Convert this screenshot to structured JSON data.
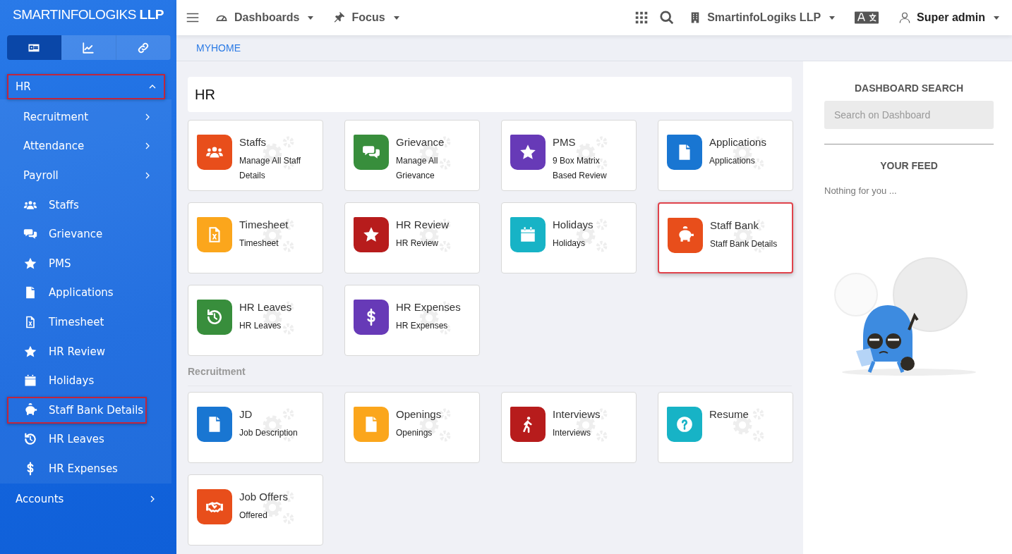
{
  "sidebar": {
    "brand": "SMARTINFOLOGIKS **LLP**",
    "tabs": [
      {
        "selected": true
      },
      {
        "selected": false
      },
      {
        "selected": false
      }
    ],
    "menu": [
      {
        "label": "HR",
        "expanded": true,
        "highlighted": true,
        "children": [
          {
            "label": "Recruitment",
            "kind": "group",
            "highlighted": false
          },
          {
            "label": "Attendance",
            "kind": "group",
            "highlighted": false
          },
          {
            "label": "Payroll",
            "kind": "group",
            "highlighted": false
          },
          {
            "label": "Staffs",
            "kind": "link",
            "highlighted": false
          },
          {
            "label": "Grievance",
            "kind": "link",
            "highlighted": false
          },
          {
            "label": "PMS",
            "kind": "link",
            "highlighted": false
          },
          {
            "label": "Applications",
            "kind": "link",
            "highlighted": false
          },
          {
            "label": "Timesheet",
            "kind": "link",
            "highlighted": false
          },
          {
            "label": "HR Review",
            "kind": "link",
            "highlighted": false
          },
          {
            "label": "Holidays",
            "kind": "link",
            "highlighted": false
          },
          {
            "label": "Staff Bank Details",
            "kind": "link",
            "highlighted": true
          },
          {
            "label": "HR Leaves",
            "kind": "link",
            "highlighted": false
          },
          {
            "label": "HR Expenses",
            "kind": "link",
            "highlighted": false
          }
        ]
      },
      {
        "label": "Accounts",
        "expanded": false,
        "highlighted": false
      }
    ]
  },
  "topbar": {
    "menus": [
      {
        "label": "Dashboards"
      },
      {
        "label": "Focus"
      }
    ],
    "company": "SmartinfoLogiks LLP",
    "user": "Super admin"
  },
  "breadcrumb": "MYHOME",
  "sections": [
    {
      "title": "HR",
      "kind": "panel",
      "cards": [
        {
          "title": "Staffs",
          "description": "Manage All Staff Details",
          "color": "#e84e1b",
          "highlighted": false
        },
        {
          "title": "Grievance",
          "description": "Manage All Grievance",
          "color": "#388e3c",
          "highlighted": false
        },
        {
          "title": "PMS",
          "description": "9 Box Matrix Based Review",
          "color": "#673ab7",
          "highlighted": false
        },
        {
          "title": "Applications",
          "description": "Applications",
          "color": "#1976d2",
          "highlighted": false
        },
        {
          "title": "Timesheet",
          "description": "Timesheet",
          "color": "#fba61c",
          "highlighted": false
        },
        {
          "title": "HR Review",
          "description": "HR Review",
          "color": "#b71c1c",
          "highlighted": false
        },
        {
          "title": "Holidays",
          "description": "Holidays",
          "color": "#17b3c6",
          "highlighted": false
        },
        {
          "title": "Staff Bank",
          "description": "Staff Bank Details",
          "color": "#e84e1b",
          "highlighted": true
        },
        {
          "title": "HR Leaves",
          "description": "HR Leaves",
          "color": "#388e3c",
          "highlighted": false
        },
        {
          "title": "HR Expenses",
          "description": "HR Expenses",
          "color": "#673ab7",
          "highlighted": false
        }
      ]
    },
    {
      "title": "Recruitment",
      "kind": "plain",
      "cards": [
        {
          "title": "JD",
          "description": "Job Description",
          "color": "#1976d2",
          "highlighted": false
        },
        {
          "title": "Openings",
          "description": "Openings",
          "color": "#fba61c",
          "highlighted": false
        },
        {
          "title": "Interviews",
          "description": "Interviews",
          "color": "#b71c1c",
          "highlighted": false
        },
        {
          "title": "Resume",
          "color": "#17b3c6",
          "highlighted": false
        },
        {
          "title": "Job Offers",
          "description": "Offered",
          "color": "#e84e1b",
          "highlighted": false
        }
      ]
    }
  ],
  "right_panel": {
    "search_title": "DASHBOARD SEARCH",
    "search_placeholder": "Search on Dashboard",
    "feed_title": "YOUR FEED",
    "feed_empty": "Nothing for you ..."
  }
}
